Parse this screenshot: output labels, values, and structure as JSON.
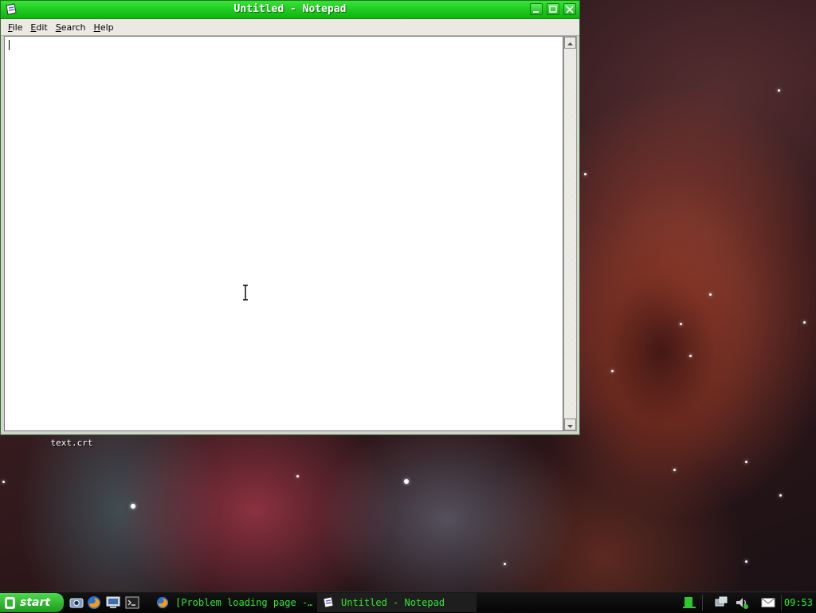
{
  "window": {
    "title": "Untitled - Notepad",
    "menu": [
      {
        "label": "File",
        "mnemonic": "F"
      },
      {
        "label": "Edit",
        "mnemonic": "E"
      },
      {
        "label": "Search",
        "mnemonic": "S"
      },
      {
        "label": "Help",
        "mnemonic": "H"
      }
    ],
    "content": ""
  },
  "desktop": {
    "icons": [
      {
        "label": "text.crt"
      }
    ]
  },
  "taskbar": {
    "start_label": "start",
    "quick_launch": [
      "screenshot-icon",
      "firefox-icon",
      "computer-icon",
      "terminal-icon"
    ],
    "tasks": [
      {
        "label": "[Problem loading page -…",
        "icon": "firefox-icon"
      },
      {
        "label": "Untitled - Notepad",
        "icon": "notepad-icon"
      }
    ],
    "tray": [
      "network-icon",
      "volume-icon",
      "mail-icon"
    ],
    "clock": "09:53"
  },
  "colors": {
    "accent": "#2cd42c",
    "taskbar_text": "#35e535",
    "taskbar_bg": "#0a0a0a"
  }
}
